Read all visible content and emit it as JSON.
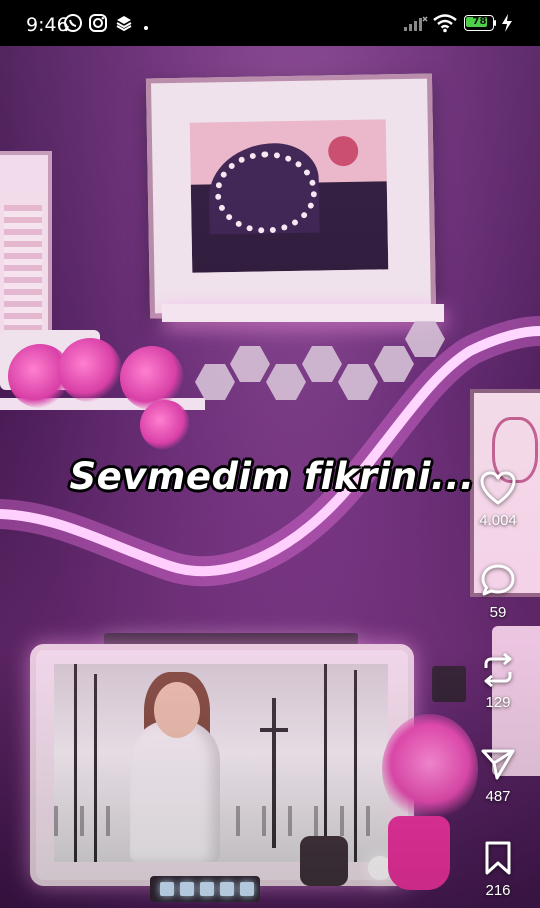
{
  "status_bar": {
    "time": "9:46",
    "battery_level": "78",
    "icons": [
      "whatsapp-icon",
      "instagram-icon",
      "layers-icon",
      "signal-icon",
      "wifi-icon",
      "battery-icon",
      "charging-icon"
    ]
  },
  "video": {
    "caption": "Sevmedim fikrini..."
  },
  "actions": {
    "like": {
      "count": "4.004",
      "icon": "heart-icon"
    },
    "comment": {
      "count": "59",
      "icon": "comment-icon"
    },
    "repost": {
      "count": "129",
      "icon": "repost-icon"
    },
    "share": {
      "count": "487",
      "icon": "send-icon"
    },
    "save": {
      "count": "216",
      "icon": "bookmark-icon"
    }
  },
  "colors": {
    "neon": "#ffd6ff",
    "wall": "#6b2f78",
    "battery_fill": "#4fd04a"
  }
}
